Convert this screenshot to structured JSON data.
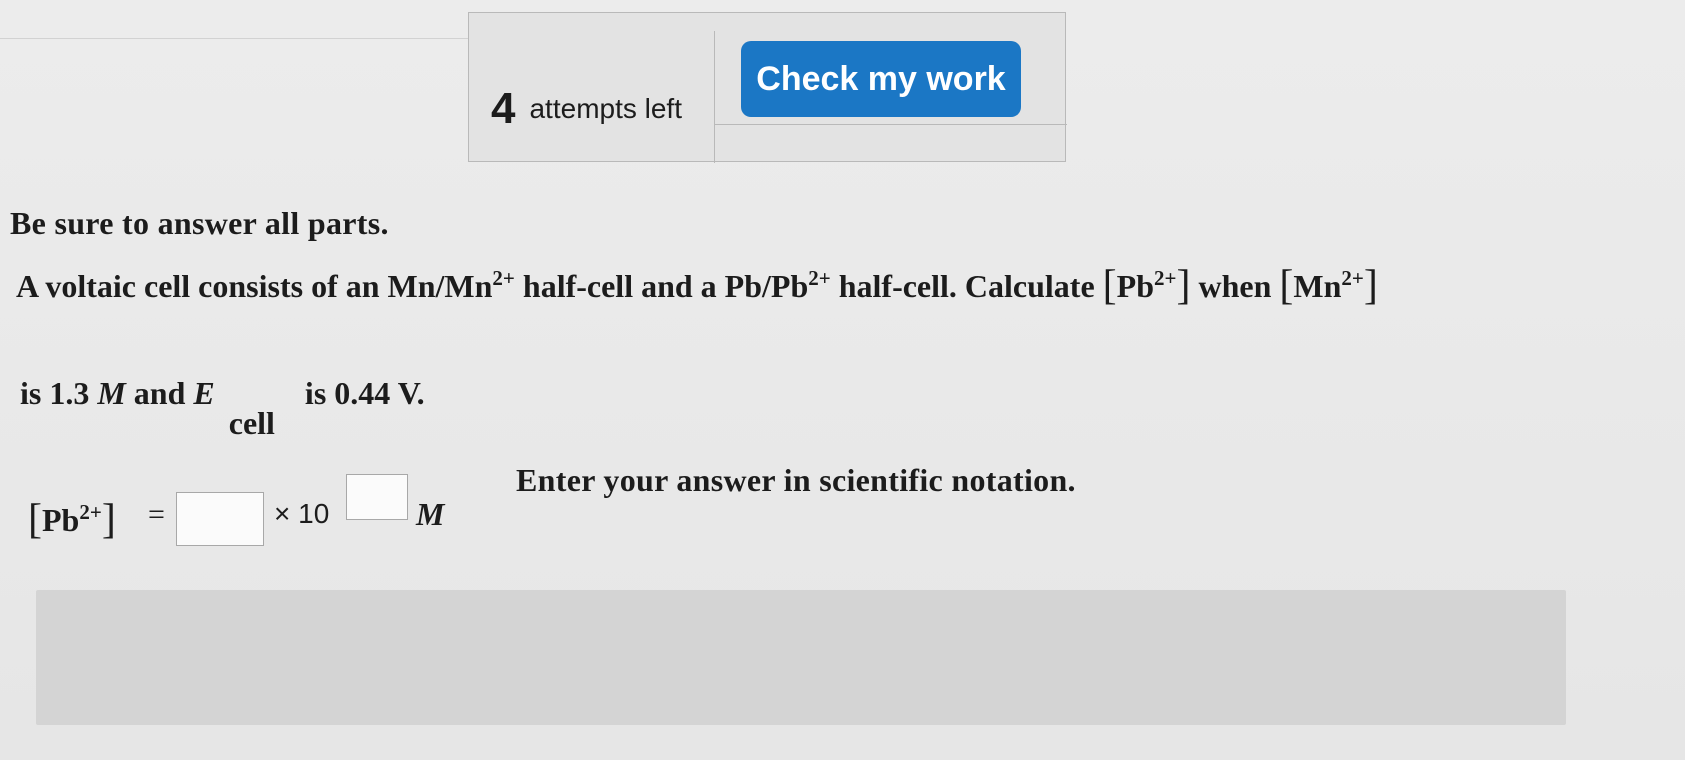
{
  "toolbar": {
    "attempts_count": "4",
    "attempts_text": "attempts left",
    "check_button": "Check my work"
  },
  "instruction": "Be sure to answer all parts.",
  "question": {
    "p1": "A voltaic cell consists of an Mn/Mn",
    "sup1": "2+",
    "p2": " half-cell and a Pb/Pb",
    "sup2": "2+",
    "p3": " half-cell. Calculate ",
    "bracket_open": "[",
    "pb": "Pb",
    "sup3": "2+",
    "bracket_close": "]",
    "p4": " when ",
    "mn": "Mn",
    "sup4": "2+",
    "line2_a": "is 1.3 ",
    "line2_m": "M",
    "line2_b": " and ",
    "line2_e": "E",
    "line2_sub": "cell",
    "line2_c": "is 0.44 V."
  },
  "answer": {
    "lhs_open": "[",
    "lhs_species": "Pb",
    "lhs_sup": "2+",
    "lhs_close": "]",
    "equals": "=",
    "coefficient_value": "",
    "times_ten": "× 10",
    "exponent_value": "",
    "unit": "M",
    "hint": "Enter your answer in scientific notation."
  },
  "colors": {
    "button_bg": "#1b77c5",
    "button_text": "#ffffff",
    "panel_bg": "#d4d4d4"
  }
}
